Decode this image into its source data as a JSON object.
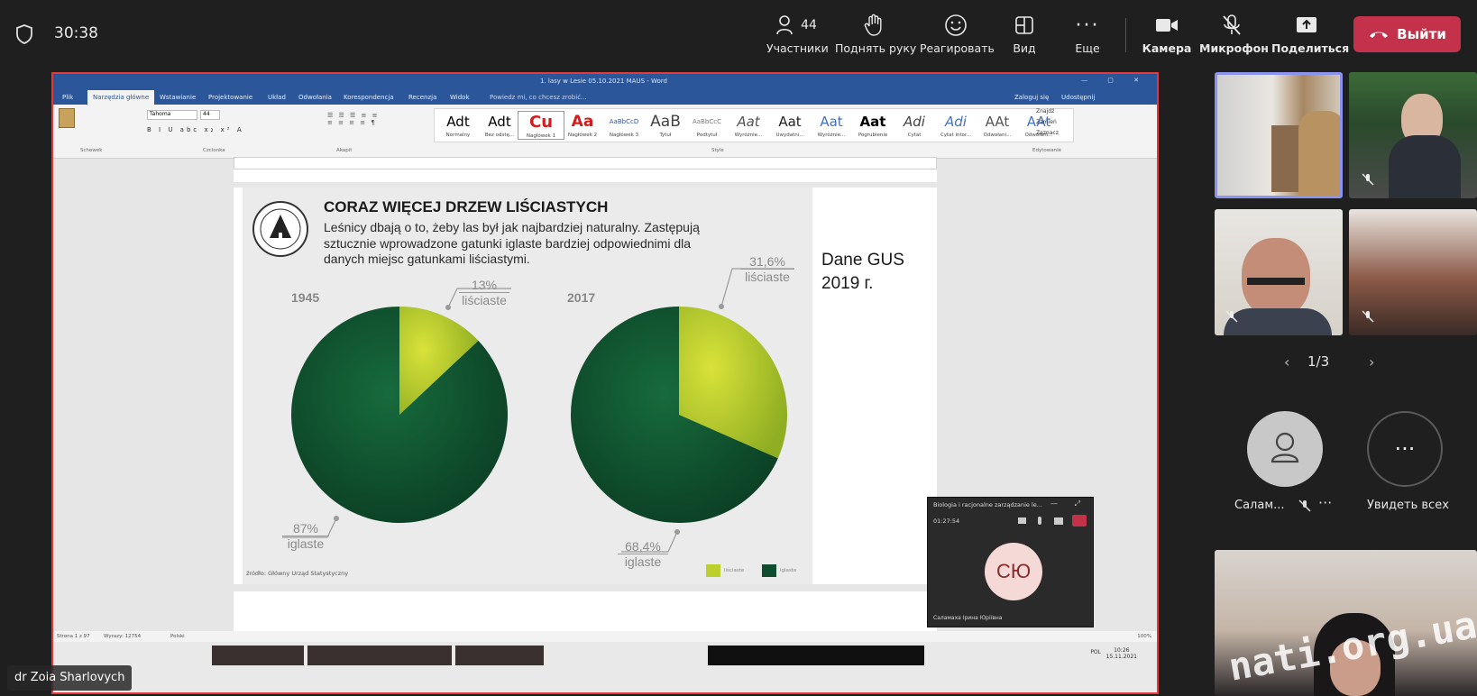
{
  "timer": "30:38",
  "toolbar": {
    "participants_count": "44",
    "participants_label": "Участники",
    "raise_hand_label": "Поднять руку",
    "react_label": "Реагировать",
    "view_label": "Вид",
    "more_label": "Еще",
    "camera_label": "Камера",
    "mic_label": "Микрофон",
    "share_label": "Поделиться",
    "leave_label": "Выйти"
  },
  "word": {
    "title": "1. lasy w Lesie 05.10.2021 MAUS - Word",
    "tabs": [
      "Plik",
      "Narzędzia główne",
      "Wstawianie",
      "Projektowanie",
      "Układ",
      "Odwołania",
      "Korespondencja",
      "Recenzja",
      "Widok"
    ],
    "search_hint": "Powiedz mi, co chcesz zrobić...",
    "share_btn": "Udostępnij",
    "signin": "Zaloguj się",
    "font_name": "Tahoma",
    "font_size": "44",
    "styles": [
      {
        "sample": "AaBbCcDd",
        "name": "Normalny"
      },
      {
        "sample": "AaBbCcDd",
        "name": "Bez odstę..."
      },
      {
        "sample": "AaBbC",
        "name": "Nagłówek 1"
      },
      {
        "sample": "AaBbCc",
        "name": "Nagłówek 2"
      },
      {
        "sample": "AaBbCcD",
        "name": "Nagłówek 3"
      },
      {
        "sample": "AaB",
        "name": "Tytuł"
      },
      {
        "sample": "AaBbCcC",
        "name": "Podtytuł"
      },
      {
        "sample": "AaBbCcDd",
        "name": "Wyróżnie..."
      },
      {
        "sample": "AaBbCcDd",
        "name": "Uwydatni..."
      },
      {
        "sample": "AaBbCcDd",
        "name": "Wyróżnie..."
      },
      {
        "sample": "AaBbCcDd",
        "name": "Pogrubienie"
      },
      {
        "sample": "AaBbCcDd",
        "name": "Cytat"
      },
      {
        "sample": "AaBbCcDd",
        "name": "Cytat intor..."
      },
      {
        "sample": "AaBbCcDd",
        "name": "Odwołani..."
      },
      {
        "sample": "AaBbCcDd",
        "name": "Odwołani..."
      }
    ],
    "find": "Znajdź",
    "replace": "Zamień",
    "select": "Zaznacz",
    "group_clipboard": "Schowek",
    "group_font": "Czcionka",
    "group_paragraph": "Akapit",
    "group_styles": "Style",
    "group_editing": "Edytowanie",
    "status_page": "Strona 1 z 97",
    "status_words": "Wyrazy: 12754",
    "status_lang": "Polski",
    "zoom": "100%",
    "clock_time": "10:26",
    "clock_date": "15.11.2021",
    "keyboard": "POL"
  },
  "slide": {
    "title": "CORAZ WIĘCEJ DRZEW LIŚCIASTYCH",
    "subtitle": "Leśnicy dbają o to, żeby las był jak najbardziej naturalny. Zastępują sztucznie wprowadzone gatunki iglaste bardziej odpowiednimi dla danych miejsc gatunkami liściastymi.",
    "logo_text": "LASY PAŃSTWOWE",
    "source": "źródło: Główny Urząd Statystyczny",
    "note_line1": "Dane GUS",
    "note_line2": "2019 г.",
    "legend_deciduous": "liściaste",
    "legend_conifer": "iglaste"
  },
  "chart_data": [
    {
      "type": "pie",
      "title": "1945",
      "categories": [
        "liściaste",
        "iglaste"
      ],
      "values": [
        13,
        87
      ],
      "labels": [
        "13%",
        "87%"
      ],
      "colors": [
        "#bccf2c",
        "#0e4d2d"
      ]
    },
    {
      "type": "pie",
      "title": "2017",
      "categories": [
        "liściaste",
        "iglaste"
      ],
      "values": [
        31.6,
        68.4
      ],
      "labels": [
        "31,6%",
        "68,4%"
      ],
      "colors": [
        "#bccf2c",
        "#0e4d2d"
      ]
    }
  ],
  "mini_window": {
    "title": "Biologia i racjonalne zarządzanie le...",
    "time": "01:27:54",
    "initials": "СЮ",
    "name": "Саламаха Ірина Юріївна"
  },
  "presenter_name": "dr Zoia Sharlovych",
  "panel": {
    "page": "1/3",
    "participant_short": "Салам...",
    "see_all": "Увидеть всех",
    "watermark": "nati.org.ua"
  },
  "colors": {
    "leave": "#c4314b",
    "share_border": "#e23a3a",
    "conifer": "#0e4d2d",
    "deciduous": "#bccf2c",
    "word_blue": "#2b579a"
  }
}
